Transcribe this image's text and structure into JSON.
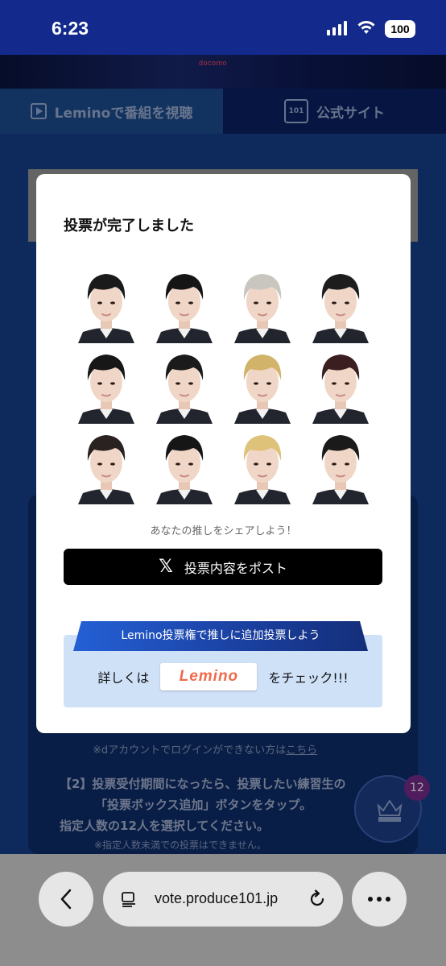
{
  "status_bar": {
    "time": "6:23",
    "battery": "100"
  },
  "banner": {
    "logo_text": "docomo"
  },
  "nav": {
    "lemino_tab": "Leminoで番組を視聴",
    "official_tab": "公式サイト",
    "official_icon_text": "101"
  },
  "background": {
    "note_login": "※dアカウントでログインができない方は",
    "note_login_link": "こちら",
    "step_line1": "【2】投票受付期間になったら、投票したい練習生の",
    "step_line2": "「投票ボックス追加」ボタンをタップ。",
    "step_line3": "指定人数の12人を選択してください。",
    "note_min": "※指定人数未満での投票はできません。",
    "vote_box_count": "12"
  },
  "modal": {
    "title": "投票が完了しました",
    "faces": [
      {
        "hair": "#1a1a1a"
      },
      {
        "hair": "#151515"
      },
      {
        "hair": "#c9c6c0"
      },
      {
        "hair": "#1d1d1d"
      },
      {
        "hair": "#171717"
      },
      {
        "hair": "#1b1b1b"
      },
      {
        "hair": "#d2b36a"
      },
      {
        "hair": "#3b1f20"
      },
      {
        "hair": "#2a2220"
      },
      {
        "hair": "#161616"
      },
      {
        "hair": "#dfc27a"
      },
      {
        "hair": "#1a1a1a"
      }
    ],
    "share_text": "あなたの推しをシェアしよう！",
    "post_button": "投票内容をポスト",
    "promo_ribbon": "Lemino投票権で推しに追加投票しよう",
    "promo_prefix": "詳しくは",
    "promo_logo": "Lemino",
    "promo_suffix": "をチェック!!!"
  },
  "browser": {
    "url": "vote.produce101.jp"
  }
}
